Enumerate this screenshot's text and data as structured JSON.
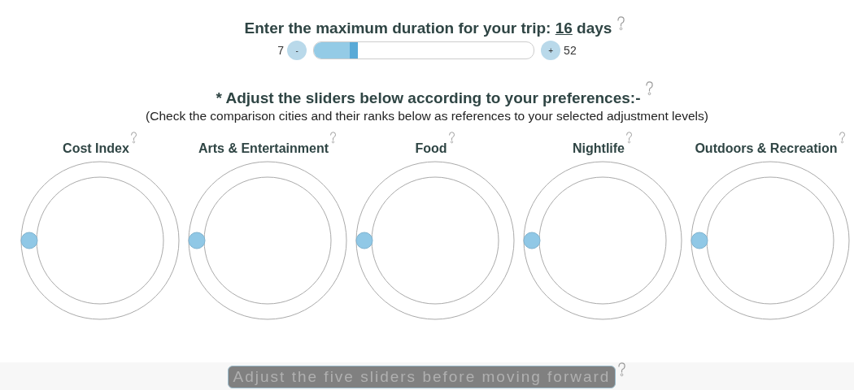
{
  "duration": {
    "prompt": "Enter the maximum duration for your trip:",
    "value": "16",
    "unit": "days",
    "min": "7",
    "max": "52",
    "minus": "-",
    "plus": "+",
    "level": 0.2
  },
  "preferences": {
    "heading": "* Adjust the sliders below according to your preferences:-",
    "subheading": "(Check the comparison cities and their ranks below as references to your selected adjustment levels)"
  },
  "sliders": [
    {
      "label": "Cost Index",
      "level": 0
    },
    {
      "label": "Arts & Entertainment",
      "level": 0
    },
    {
      "label": "Food",
      "level": 0
    },
    {
      "label": "Nightlife",
      "level": 0
    },
    {
      "label": "Outdoors & Recreation",
      "level": 0
    }
  ],
  "submit": {
    "label": "Adjust the five sliders before moving forward",
    "disabled": true
  }
}
